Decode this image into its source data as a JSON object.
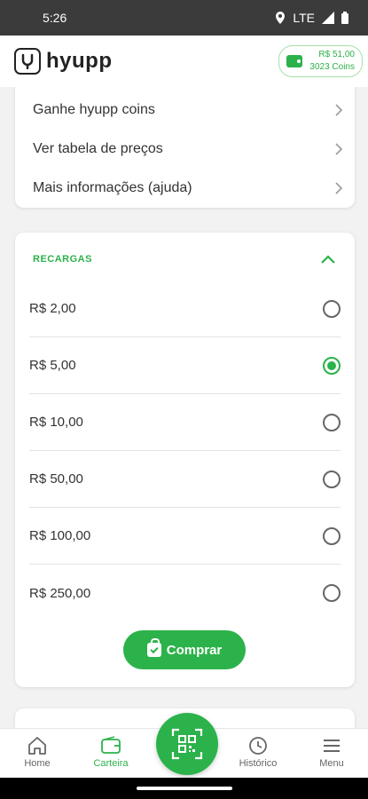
{
  "status_bar": {
    "time": "5:26",
    "network": "LTE"
  },
  "header": {
    "logo_text": "hyupp",
    "balance_money": "R$ 51,00",
    "balance_coins": "3023 Coins"
  },
  "links": [
    {
      "label": "Ganhe hyupp coins",
      "icon": "chevron-right-icon"
    },
    {
      "label": "Ver tabela de preços",
      "icon": "chevron-right-icon"
    },
    {
      "label": "Mais informações (ajuda)",
      "icon": "chevron-right-icon"
    }
  ],
  "recharge": {
    "title": "RECARGAS",
    "options": [
      {
        "label": "R$ 2,00",
        "selected": false
      },
      {
        "label": "R$ 5,00",
        "selected": true
      },
      {
        "label": "R$ 10,00",
        "selected": false
      },
      {
        "label": "R$ 50,00",
        "selected": false
      },
      {
        "label": "R$ 100,00",
        "selected": false
      },
      {
        "label": "R$ 250,00",
        "selected": false
      }
    ],
    "buy_label": "Comprar"
  },
  "nav": {
    "home": "Home",
    "wallet": "Carteira",
    "history": "Histórico",
    "menu": "Menu",
    "active": "wallet"
  },
  "colors": {
    "accent": "#2cb24a"
  }
}
